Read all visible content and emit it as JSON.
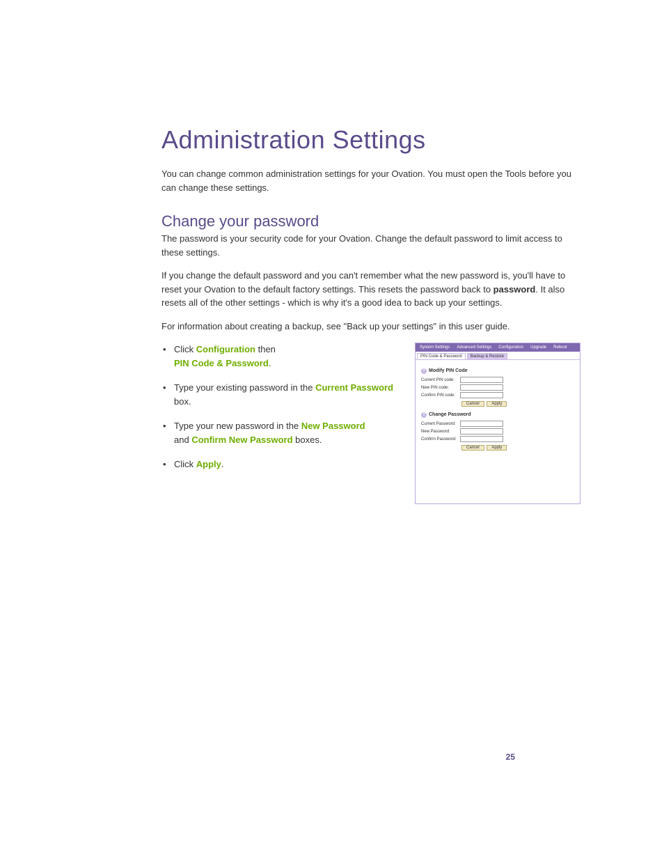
{
  "title": "Administration Settings",
  "intro": "You can change common administration settings for your Ovation. You must open the Tools before you can change these settings.",
  "section_heading": "Change your password",
  "para1": "The password is your security code for your Ovation. Change the default password to limit access to these settings.",
  "para2_pre": "If you change the default password and you can't remember what the new password is, you'll have to reset your Ovation to the default factory settings. This resets the password back to ",
  "para2_bold": "password",
  "para2_post": ". It also resets all of the other settings - which is why it's a good idea to back up your settings.",
  "para3": "For information about creating a backup, see \"Back up your settings\" in this user guide.",
  "steps": {
    "s1_a": "Click ",
    "s1_b": "Configuration",
    "s1_c": " then ",
    "s1_d": "PIN Code & Password",
    "s1_e": ".",
    "s2_a": "Type your existing password in the ",
    "s2_b": "Current Password",
    "s2_c": " box.",
    "s3_a": "Type your new password in the ",
    "s3_b": "New Password",
    "s3_c": " and ",
    "s3_d": "Confirm New Password",
    "s3_e": " boxes.",
    "s4_a": "Click ",
    "s4_b": "Apply",
    "s4_c": "."
  },
  "screenshot": {
    "topnav": [
      "System Settings",
      "Advanced Settings",
      "Configuration",
      "Upgrade",
      "Reboot"
    ],
    "subtabs": {
      "active": "PIN Code & Password",
      "other": "Backup & Restore"
    },
    "modify_pin": {
      "title": "Modify PIN Code",
      "rows": [
        "Current PIN code:",
        "New PIN code:",
        "Confirm PIN code:"
      ]
    },
    "change_pw": {
      "title": "Change Password",
      "rows": [
        "Current Password:",
        "New Password:",
        "Confirm Password:"
      ]
    },
    "buttons": {
      "cancel": "Cancel",
      "apply": "Apply"
    }
  },
  "page_number": "25"
}
